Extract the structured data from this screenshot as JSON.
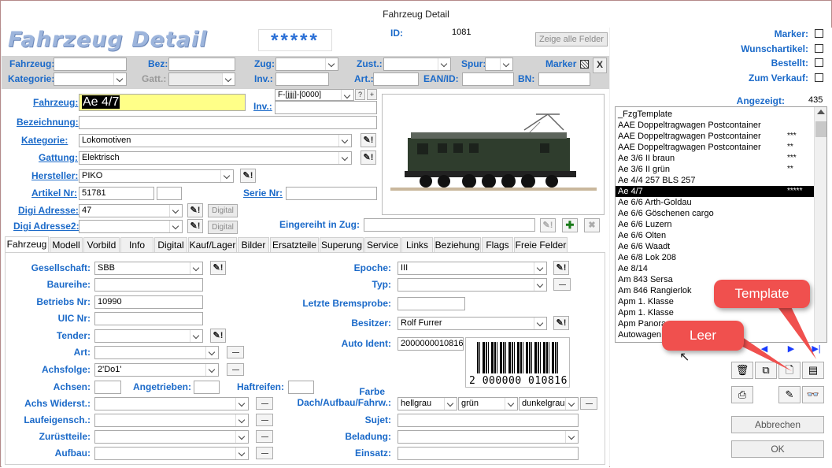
{
  "window_title": "Fahrzeug Detail",
  "header": {
    "title": "Fahrzeug Detail",
    "stars": "*****",
    "id_label": "ID:",
    "id_value": "1081",
    "show_all_fields": "Zeige alle Felder"
  },
  "filter": {
    "fahrzeug": "Fahrzeug:",
    "bez": "Bez:",
    "zug": "Zug:",
    "zust": "Zust.:",
    "spur": "Spur:",
    "marker": "Marker",
    "close": "X",
    "kategorie": "Kategorie:",
    "gatt": "Gatt.:",
    "inv": "Inv.:",
    "art": "Art.:",
    "ean": "EAN/ID:",
    "bn": "BN:"
  },
  "form": {
    "fahrzeug_label": "Fahrzeug:",
    "fahrzeug_value": "Ae 4/7",
    "inv_label": "Inv.:",
    "inv_format": "F-[jjjj]-[0000]",
    "q_btn": "?",
    "plus_btn": "+",
    "bezeichnung_label": "Bezeichnung:",
    "kategorie_label": "Kategorie:",
    "kategorie_value": "Lokomotiven",
    "gattung_label": "Gattung:",
    "gattung_value": "Elektrisch",
    "hersteller_label": "Hersteller:",
    "hersteller_value": "PIKO",
    "artikel_label": "Artikel Nr:",
    "artikel_value": "51781",
    "serie_label": "Serie Nr:",
    "digi_label": "Digi Adresse:",
    "digi_value": "47",
    "digital_btn": "Digital",
    "digi2_label": "Digi Adresse2:",
    "digital2_btn": "Digital",
    "eingereiht_label": "Eingereiht in Zug:",
    "pen": "✎!"
  },
  "tabs": [
    "Fahrzeug",
    "Modell",
    "Vorbild",
    "Info",
    "Digital",
    "Kauf/Lager",
    "Bilder",
    "Ersatzteile",
    "Superung",
    "Service",
    "Links",
    "Beziehung",
    "Flags",
    "Freie Felder"
  ],
  "detail": {
    "gesellschaft_label": "Gesellschaft:",
    "gesellschaft_value": "SBB",
    "baureihe_label": "Baureihe:",
    "betriebs_label": "Betriebs Nr:",
    "betriebs_value": "10990",
    "uic_label": "UIC Nr:",
    "tender_label": "Tender:",
    "art_label": "Art:",
    "achsfolge_label": "Achsfolge:",
    "achsfolge_value": "2'Do1'",
    "achsen_label": "Achsen:",
    "angetrieben_label": "Angetrieben:",
    "haftreifen_label": "Haftreifen:",
    "achswid_label": "Achs Widerst.:",
    "laufeig_label": "Laufeigensch.:",
    "zuruest_label": "Zurüstteile:",
    "aufbau_label": "Aufbau:",
    "epoche_label": "Epoche:",
    "epoche_value": "III",
    "typ_label": "Typ:",
    "bremsprobe_label": "Letzte Bremsprobe:",
    "besitzer_label": "Besitzer:",
    "besitzer_value": "Rolf Furrer",
    "autoident_label": "Auto Ident:",
    "autoident_value": "2000000010816",
    "barcode_text": "2 000000 010816",
    "farbe_label1": "Farbe",
    "farbe_label2": "Dach/Aufbau/Fahrw.:",
    "farbe1": "hellgrau",
    "farbe2": "grün",
    "farbe3": "dunkelgrau",
    "sujet_label": "Sujet:",
    "beladung_label": "Beladung:",
    "einsatz_label": "Einsatz:"
  },
  "right": {
    "marker": "Marker:",
    "wunsch": "Wunschartikel:",
    "bestellt": "Bestellt:",
    "verkauf": "Zum Verkauf:",
    "angezeigt_label": "Angezeigt:",
    "angezeigt_value": "435",
    "list": [
      {
        "name": "_FzgTemplate",
        "stars": ""
      },
      {
        "name": "AAE Doppeltragwagen Postcontainer",
        "stars": ""
      },
      {
        "name": "AAE Doppeltragwagen Postcontainer",
        "stars": "***"
      },
      {
        "name": "AAE Doppeltragwagen Postcontainer",
        "stars": "**"
      },
      {
        "name": "Ae 3/6 II braun",
        "stars": "***"
      },
      {
        "name": "Ae 3/6 II grün",
        "stars": "**"
      },
      {
        "name": "Ae 4/4 257 BLS 257",
        "stars": ""
      },
      {
        "name": "Ae 4/7",
        "stars": "*****"
      },
      {
        "name": "Ae 6/6 Arth-Goldau",
        "stars": ""
      },
      {
        "name": "Ae 6/6 Göschenen cargo",
        "stars": ""
      },
      {
        "name": "Ae 6/6 Luzern",
        "stars": ""
      },
      {
        "name": "Ae 6/6 Olten",
        "stars": ""
      },
      {
        "name": "Ae 6/6 Waadt",
        "stars": ""
      },
      {
        "name": "Ae 6/8 Lok 208",
        "stars": ""
      },
      {
        "name": "Ae 8/14",
        "stars": ""
      },
      {
        "name": "Am 843 Sersa",
        "stars": ""
      },
      {
        "name": "Am 846 Rangierlok",
        "stars": ""
      },
      {
        "name": "Apm 1. Klasse",
        "stars": ""
      },
      {
        "name": "Apm 1. Klasse",
        "stars": ""
      },
      {
        "name": "Apm Panoramawagen",
        "stars": ""
      },
      {
        "name": "Autowagen",
        "stars": ""
      }
    ],
    "abbrechen": "Abbrechen",
    "ok": "OK"
  },
  "callouts": {
    "template": "Template",
    "leer": "Leer"
  },
  "colors": {
    "label_blue": "#1b6ac9",
    "callout_red": "#f0504e",
    "highlight_yellow": "#ffff88"
  }
}
